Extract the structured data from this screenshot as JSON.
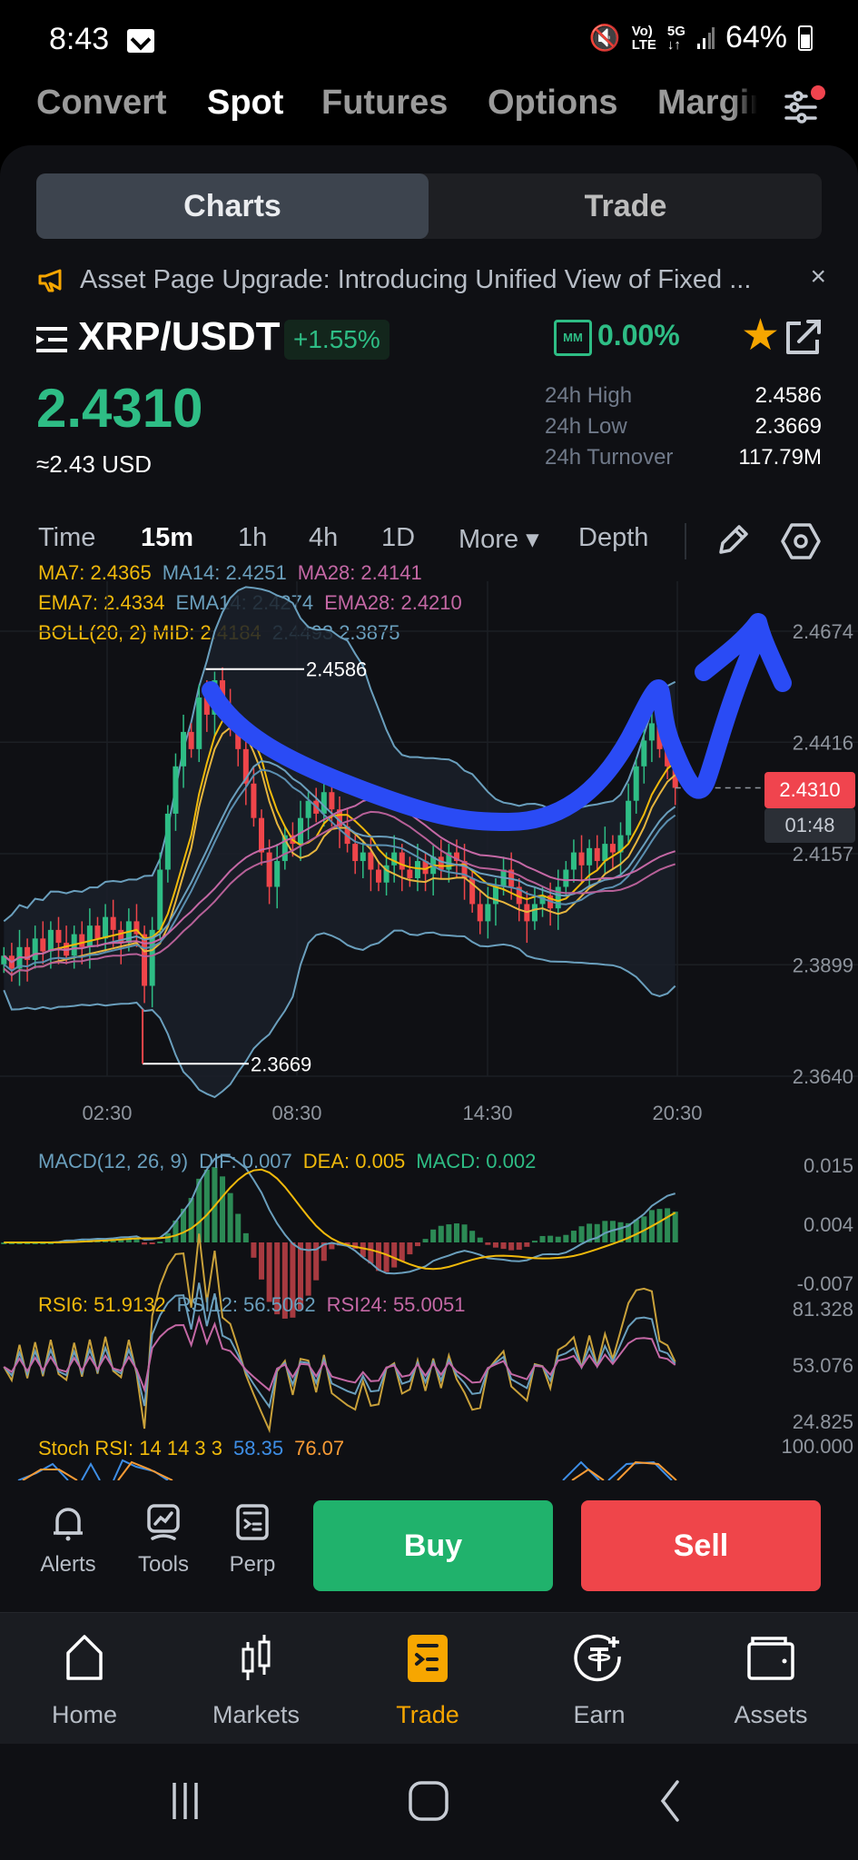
{
  "status_bar": {
    "time": "8:43",
    "battery": "64%",
    "icons": [
      "mail-icon",
      "mute-icon",
      "volte-icon",
      "5g-icon",
      "signal-icon",
      "battery-icon"
    ]
  },
  "top_tabs": [
    {
      "label": "Convert",
      "active": false
    },
    {
      "label": "Spot",
      "active": true
    },
    {
      "label": "Futures",
      "active": false
    },
    {
      "label": "Options",
      "active": false
    },
    {
      "label": "Margin",
      "active": false
    }
  ],
  "segment": {
    "charts": "Charts",
    "trade": "Trade",
    "active": "Charts"
  },
  "announcement": {
    "text": "Asset Page Upgrade: Introducing Unified View of Fixed ...",
    "close": "×"
  },
  "pair": {
    "name": "XRP/USDT",
    "change": "+1.55%",
    "mm_badge": "MM",
    "mm_value": "0.00%",
    "favorite": true
  },
  "price": {
    "last": "2.4310",
    "usd": "≈2.43 USD"
  },
  "stats": [
    {
      "label": "24h High",
      "value": "2.4586"
    },
    {
      "label": "24h Low",
      "value": "2.3669"
    },
    {
      "label": "24h Turnover",
      "value": "117.79M"
    }
  ],
  "intervals": [
    {
      "label": "Time",
      "active": false
    },
    {
      "label": "15m",
      "active": true
    },
    {
      "label": "1h",
      "active": false
    },
    {
      "label": "4h",
      "active": false
    },
    {
      "label": "1D",
      "active": false
    },
    {
      "label": "More ▾",
      "active": false
    },
    {
      "label": "Depth",
      "active": false
    }
  ],
  "indicators": {
    "ma": [
      "MA7: 2.4365",
      "MA14: 2.4251",
      "MA28: 2.4141"
    ],
    "ema": [
      "EMA7: 2.4334",
      "EMA14: 2.4274",
      "EMA28: 2.4210"
    ],
    "boll": [
      "BOLL(20, 2) MID: 2.4184",
      "2.4493 2.3875"
    ],
    "macd": [
      "MACD(12, 26, 9)",
      "DIF: 0.007",
      "DEA: 0.005",
      "MACD: 0.002"
    ],
    "rsi": [
      "RSI6: 51.9132",
      "RSI12: 56.5062",
      "RSI24: 55.0051"
    ],
    "stoch": [
      "Stoch RSI: 14 14 3 3",
      "58.35",
      "76.07"
    ]
  },
  "chart_data": {
    "type": "candlestick",
    "title": "XRP/USDT 15m",
    "x_ticks": [
      "02:30",
      "08:30",
      "14:30",
      "20:30"
    ],
    "y_ticks": [
      "2.4674",
      "2.4416",
      "2.4157",
      "2.3899",
      "2.3640"
    ],
    "y_range": [
      2.364,
      2.4674
    ],
    "last_price": 2.431,
    "last_price_label": "2.4310",
    "countdown": "01:48",
    "high_marker": {
      "value": 2.4586,
      "label": "2.4586"
    },
    "low_marker": {
      "value": 2.3669,
      "label": "2.3669"
    },
    "close_series": [
      2.392,
      2.389,
      2.394,
      2.391,
      2.396,
      2.393,
      2.398,
      2.395,
      2.392,
      2.397,
      2.394,
      2.399,
      2.396,
      2.401,
      2.398,
      2.395,
      2.4,
      2.397,
      2.385,
      2.398,
      2.412,
      2.425,
      2.436,
      2.444,
      2.44,
      2.452,
      2.448,
      2.456,
      2.45,
      2.446,
      2.44,
      2.432,
      2.424,
      2.416,
      2.408,
      2.414,
      2.42,
      2.418,
      2.424,
      2.428,
      2.425,
      2.43,
      2.426,
      2.422,
      2.418,
      2.414,
      2.416,
      2.412,
      2.409,
      2.413,
      2.416,
      2.412,
      2.41,
      2.414,
      2.411,
      2.415,
      2.412,
      2.416,
      2.414,
      2.41,
      2.404,
      2.4,
      2.404,
      2.408,
      2.412,
      2.408,
      2.404,
      2.4,
      2.404,
      2.406,
      2.403,
      2.408,
      2.412,
      2.416,
      2.413,
      2.417,
      2.414,
      2.418,
      2.416,
      2.42,
      2.428,
      2.436,
      2.442,
      2.446,
      2.44,
      2.436,
      2.431
    ],
    "macd": {
      "y_ticks": [
        "0.015",
        "0.004",
        "-0.007"
      ],
      "y_range": [
        -0.007,
        0.015
      ]
    },
    "rsi": {
      "y_ticks": [
        "81.328",
        "53.076",
        "24.825"
      ],
      "y_range": [
        24.825,
        81.328
      ]
    },
    "stoch_rsi": {
      "y_ticks": [
        "100.000"
      ]
    }
  },
  "actions": {
    "alerts": "Alerts",
    "tools": "Tools",
    "perp": "Perp",
    "buy": "Buy",
    "sell": "Sell"
  },
  "bottom_nav": [
    {
      "label": "Home",
      "icon": "home-icon",
      "active": false
    },
    {
      "label": "Markets",
      "icon": "markets-icon",
      "active": false
    },
    {
      "label": "Trade",
      "icon": "trade-icon",
      "active": true
    },
    {
      "label": "Earn",
      "icon": "earn-icon",
      "active": false
    },
    {
      "label": "Assets",
      "icon": "assets-icon",
      "active": false
    }
  ],
  "colors": {
    "up": "#2ebd85",
    "down": "#ef454a",
    "accent": "#f7a600",
    "annotation": "#2a4bf5"
  }
}
